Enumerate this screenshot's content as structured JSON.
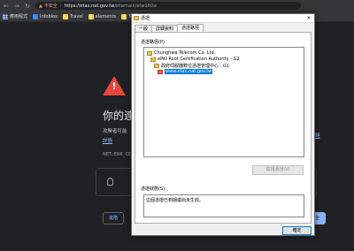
{
  "browser": {
    "nav": {
      "back": "←",
      "forward": "→",
      "reload": "↻"
    },
    "address": {
      "warning_icon": "▲",
      "not_secure": "不安全",
      "separator": "|",
      "host": "https://etax.nat.gov.tw",
      "path": "/etwmain/etw160w"
    },
    "bookmarks": [
      {
        "icon": "apps-grid-icon",
        "label": "應用程式"
      },
      {
        "icon": "infoblox-icon",
        "label": "Infoblox"
      },
      {
        "icon": "folder-icon",
        "label": "Travel"
      },
      {
        "icon": "folder-icon",
        "label": "elements"
      },
      {
        "icon": "folder-icon",
        "label": "Tech"
      }
    ]
  },
  "error_page": {
    "icon_glyph": "!",
    "title": "你的連",
    "body_line": "攻擊者可能",
    "link_text": "詳情",
    "report_link": "鏈",
    "code": "NET::ERR_CE",
    "advanced_label": "進階",
    "back_label": "安全"
  },
  "dialog": {
    "title": "憑證",
    "close_glyph": "✕",
    "tabs": [
      {
        "label": "一般",
        "active": false
      },
      {
        "label": "詳細資料",
        "active": false
      },
      {
        "label": "憑證路徑",
        "active": true
      }
    ],
    "path_label": "憑證路徑(P)",
    "tree": [
      {
        "label": "Chunghwa Telecom Co. Ltd.",
        "depth": 0,
        "selected": false,
        "error": false
      },
      {
        "label": "ePKI Root Certification Authority - G2",
        "depth": 1,
        "selected": false,
        "error": false
      },
      {
        "label": "政府伺服器數位憑證管理中心 - G1",
        "depth": 2,
        "selected": false,
        "error": false
      },
      {
        "label": "www.etax.nat.gov.tw",
        "depth": 3,
        "selected": true,
        "error": true
      }
    ],
    "view_cert_label": "檢視憑證(V)",
    "status_label": "憑證狀態(S):",
    "status_text": "這個憑證已到期或尚未生效。",
    "ok_label": "確定"
  }
}
